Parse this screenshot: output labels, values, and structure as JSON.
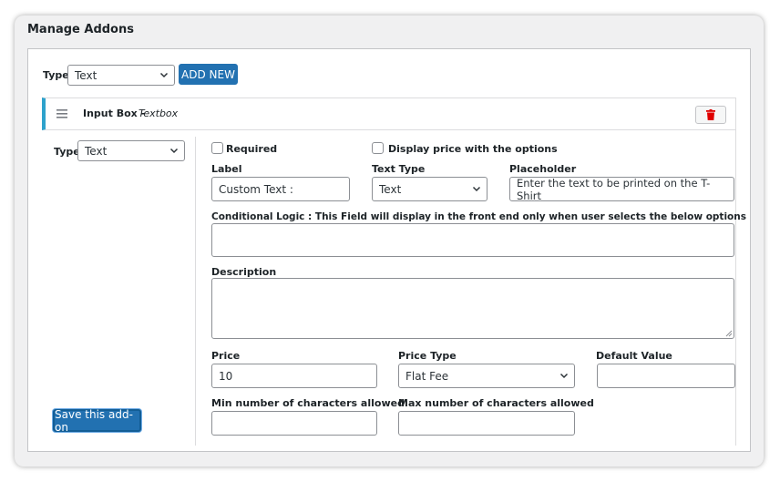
{
  "card": {
    "title": "Manage Addons"
  },
  "top": {
    "type_label": "Type",
    "type_value": "Text",
    "add_new_label": "ADD NEW"
  },
  "addon": {
    "title_bold": "Input Box -",
    "title_italic": "Textbox",
    "side": {
      "type_label": "Type",
      "type_value": "Text",
      "save_label": "Save this add-on"
    },
    "required_label": "Required",
    "display_price_label": "Display price with the options",
    "label_label": "Label",
    "label_value": "Custom Text :",
    "text_type_label": "Text Type",
    "text_type_value": "Text",
    "placeholder_label": "Placeholder",
    "placeholder_value": "Enter the text to be printed on the T-Shirt",
    "conditional_label": "Conditional Logic : This Field will display in the front end only when user selects the below options",
    "conditional_value": "",
    "description_label": "Description",
    "description_value": "",
    "price_label": "Price",
    "price_value": "10",
    "price_type_label": "Price Type",
    "price_type_value": "Flat Fee",
    "default_value_label": "Default Value",
    "default_value_value": "",
    "min_chars_label": "Min number of characters allowed",
    "min_chars_value": "",
    "max_chars_label": "Max number of characters allowed",
    "max_chars_value": ""
  },
  "colors": {
    "accent": "#2271b1",
    "head_border": "#2ea2cc",
    "trash": "#d63638"
  },
  "icons": {
    "drag": "drag-handle-icon",
    "trash": "trash-icon",
    "chevron": "chevron-down-icon"
  }
}
